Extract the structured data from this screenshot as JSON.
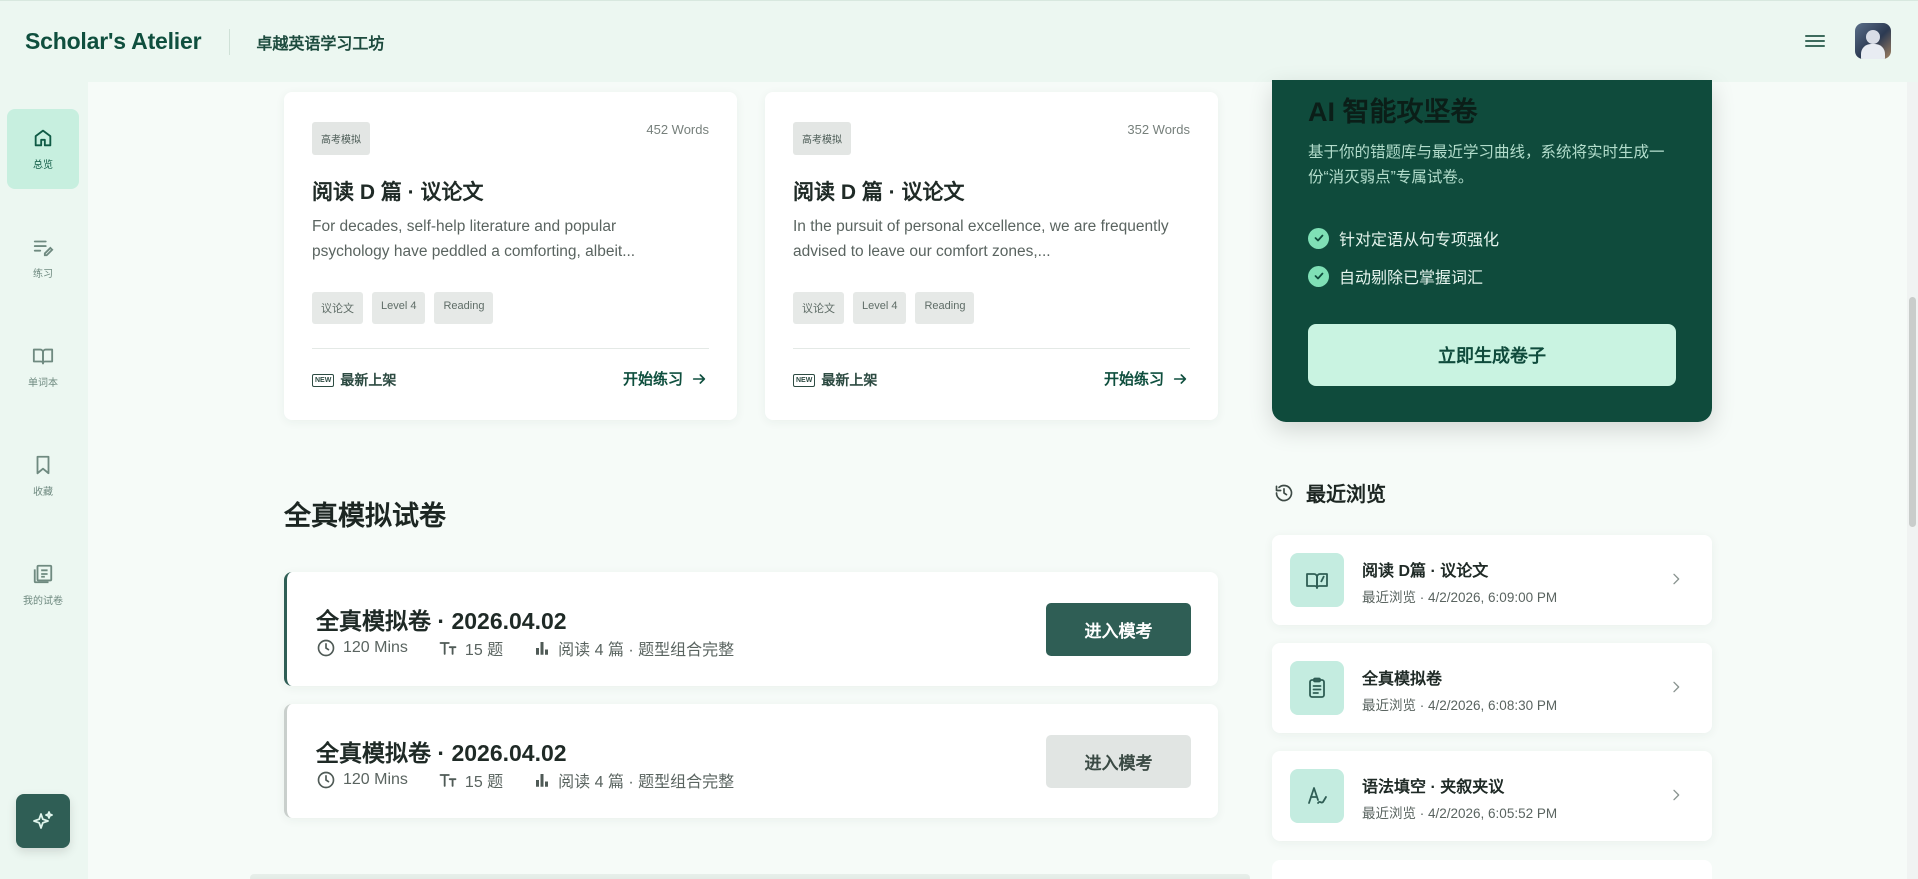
{
  "header": {
    "brand": "Scholar's Atelier",
    "subtitle": "卓越英语学习工坊",
    "menu_icon": "hamburger-menu-icon",
    "avatar_icon": "user-avatar"
  },
  "sidebar": {
    "items": [
      {
        "label": "总览",
        "icon": "home-icon",
        "active": true
      },
      {
        "label": "练习",
        "icon": "edit-list-icon",
        "active": false
      },
      {
        "label": "单词本",
        "icon": "book-open-icon",
        "active": false
      },
      {
        "label": "收藏",
        "icon": "bookmark-icon",
        "active": false
      },
      {
        "label": "我的试卷",
        "icon": "newspaper-icon",
        "active": false
      }
    ],
    "fab_icon": "sparkles-icon"
  },
  "articles": [
    {
      "tag": "高考模拟",
      "words": "452 Words",
      "title": "阅读 D 篇 · 议论文",
      "desc": "For decades, self-help literature and popular psychology have peddled a comforting, albeit...",
      "chips": [
        "议论文",
        "Level 4",
        "Reading"
      ],
      "new_label": "最新上架",
      "start_label": "开始练习"
    },
    {
      "tag": "高考模拟",
      "words": "352 Words",
      "title": "阅读 D 篇 · 议论文",
      "desc": "In the pursuit of personal excellence, we are frequently advised to leave our comfort zones,...",
      "chips": [
        "议论文",
        "Level 4",
        "Reading"
      ],
      "new_label": "最新上架",
      "start_label": "开始练习"
    }
  ],
  "ai_card": {
    "title": "AI 智能攻坚卷",
    "desc": "基于你的错题库与最近学习曲线，系统将实时生成一份“消灭弱点”专属试卷。",
    "checks": [
      "针对定语从句专项强化",
      "自动剔除已掌握词汇"
    ],
    "button": "立即生成卷子"
  },
  "exams": {
    "section_title": "全真模拟试卷",
    "items": [
      {
        "title": "全真模拟卷 · 2026.04.02",
        "duration": "120 Mins",
        "count": "15 题",
        "structure": "阅读 4 篇 · 题型组合完整",
        "button": "进入模考"
      },
      {
        "title": "全真模拟卷 · 2026.04.02",
        "duration": "120 Mins",
        "count": "15 题",
        "structure": "阅读 4 篇 · 题型组合完整",
        "button": "进入模考"
      }
    ]
  },
  "recent": {
    "title": "最近浏览",
    "items": [
      {
        "title": "阅读 D篇 · 议论文",
        "sub": "最近浏览 · 4/2/2026, 6:09:00 PM",
        "icon": "book-reading-icon"
      },
      {
        "title": "全真模拟卷",
        "sub": "最近浏览 · 4/2/2026, 6:08:30 PM",
        "icon": "clipboard-icon"
      },
      {
        "title": "语法填空 · 夹叙夹议",
        "sub": "最近浏览 · 4/2/2026, 6:05:52 PM",
        "icon": "handwriting-icon"
      }
    ]
  }
}
